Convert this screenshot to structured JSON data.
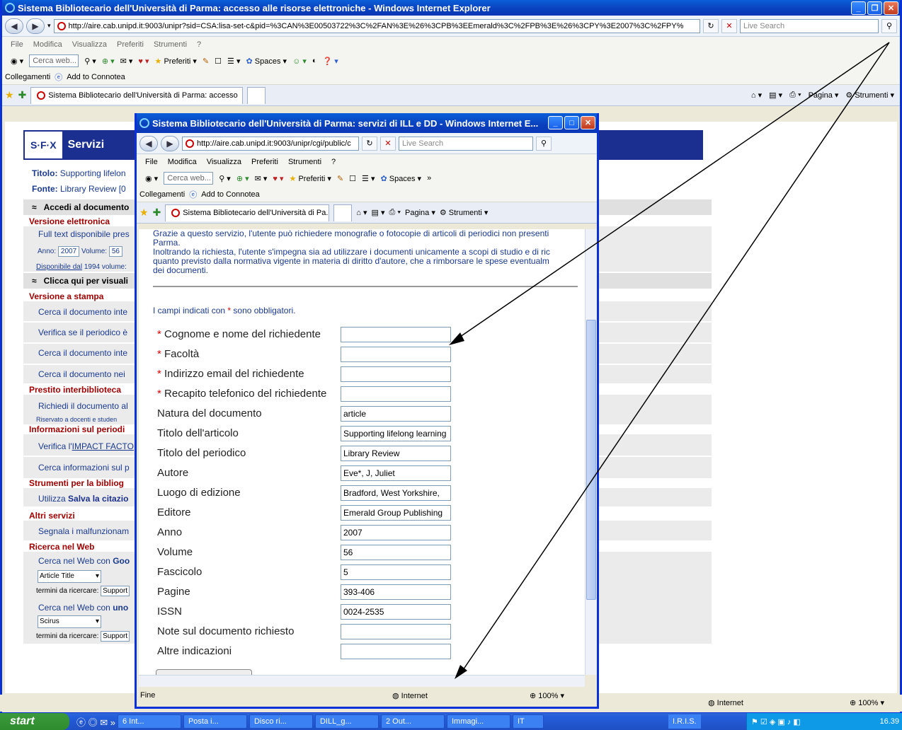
{
  "outer": {
    "title": "Sistema Bibliotecario dell'Università di Parma: accesso alle risorse elettroniche - Windows Internet Explorer",
    "address": "http://aire.cab.unipd.it:9003/unipr?sid=CSA:lisa-set-c&pid=%3CAN%3E00503722%3C%2FAN%3E%26%3CPB%3EEmerald%3C%2FPB%3E%26%3CPY%3E2007%3C%2FPY%",
    "search_placeholder": "Live Search",
    "menu": [
      "File",
      "Modifica",
      "Visualizza",
      "Preferiti",
      "Strumenti",
      "?"
    ],
    "search_web": "Cerca web...",
    "preferiti": "Preferiti",
    "spaces": "Spaces",
    "links_label": "Collegamenti",
    "add_connotea": "Add to Connotea",
    "tab": "Sistema Bibliotecario dell'Università di Parma: accesso",
    "pagina": "Pagina",
    "strumenti": "Strumenti",
    "status_zone": "Internet",
    "zoom": "100%"
  },
  "sfx": {
    "logo": "S·F·X",
    "header": "Servizi",
    "titolo_label": "Titolo:",
    "titolo_val": "Supporting lifelon",
    "fonte_label": "Fonte:",
    "fonte_val": "Library Review [0",
    "accedi": "Accedi al documento",
    "versione_elettronica": "Versione elettronica",
    "full_text": "Full text disponibile pres",
    "anno_label": "Anno:",
    "anno_val": "2007",
    "volume_label": "Volume:",
    "volume_val": "56",
    "disponibile": "Disponibile dal",
    "disponibile_rest": "1994 volume:",
    "clicca": "Clicca qui per visuali",
    "versione_stampa": "Versione a stampa",
    "cerca1": "Cerca il documento inte",
    "verifica": "Verifica se il periodico è",
    "cerca2": "Cerca il documento inte",
    "cerca3": "Cerca il documento nei",
    "prestito": "Prestito interbiblioteca",
    "richiedi": "Richiedi il documento al",
    "riservato": "Riservato a docenti e studen",
    "informazioni": "Informazioni sul periodi",
    "verifica_impact": "Verifica l'",
    "impact_link": "IMPACT FACTO",
    "cerca_info": "Cerca informazioni sul p",
    "strumenti_biblio": "Strumenti per la bibliog",
    "utilizza": "Utilizza",
    "salva": "Salva la citazio",
    "altri": "Altri servizi",
    "segnala": "Segnala i malfunzionam",
    "ricerca_web": "Ricerca nel Web",
    "cerca_goo": "Cerca nel Web con",
    "goo": "Goo",
    "select1": "Article Title",
    "termini1": "termini da ricercare:",
    "termini_val": "Support",
    "cerca_uno": "Cerca nel Web con",
    "uno": "uno",
    "select2": "Scirus",
    "termini2": "termini da ricercare:"
  },
  "inner": {
    "title": "Sistema Bibliotecario dell'Università di Parma: servizi di ILL e DD - Windows Internet E...",
    "address": "http://aire.cab.unipd.it:9003/unipr/cgi/public/c",
    "search_placeholder": "Live Search",
    "menu": [
      "File",
      "Modifica",
      "Visualizza",
      "Preferiti",
      "Strumenti",
      "?"
    ],
    "search_web": "Cerca web...",
    "preferiti": "Preferiti",
    "spaces": "Spaces",
    "links_label": "Collegamenti",
    "add_connotea": "Add to Connotea",
    "tab": "Sistema Bibliotecario dell'Università di Pa...",
    "pagina": "Pagina",
    "strumenti": "Strumenti",
    "intro1": "Grazie a questo servizio, l'utente può richiedere monografie o fotocopie di articoli di periodici non presenti",
    "intro2": "Parma.",
    "intro3": "Inoltrando la richiesta, l'utente s'impegna sia ad utilizzare i documenti unicamente a scopi di studio e di ric",
    "intro4": "quanto previsto dalla normativa vigente in materia di diritto d'autore, che a rimborsare le spese eventualm",
    "intro5": "dei documenti.",
    "required_note_a": "I campi indicati con",
    "required_star": "*",
    "required_note_b": "sono obbligatori.",
    "status_left": "Fine",
    "status_zone": "Internet",
    "zoom": "100%",
    "fields": [
      {
        "label": "Cognome e nome del richiedente",
        "required": true,
        "value": ""
      },
      {
        "label": "Facoltà",
        "required": true,
        "value": ""
      },
      {
        "label": "Indirizzo email del richiedente",
        "required": true,
        "value": ""
      },
      {
        "label": "Recapito telefonico del richiedente",
        "required": true,
        "value": ""
      },
      {
        "label": "Natura del documento",
        "required": false,
        "value": "article"
      },
      {
        "label": "Titolo dell'articolo",
        "required": false,
        "value": "Supporting lifelong learning"
      },
      {
        "label": "Titolo del periodico",
        "required": false,
        "value": "Library Review"
      },
      {
        "label": "Autore",
        "required": false,
        "value": "Eve*, J, Juliet"
      },
      {
        "label": "Luogo di edizione",
        "required": false,
        "value": "Bradford, West Yorkshire,"
      },
      {
        "label": "Editore",
        "required": false,
        "value": "Emerald Group Publishing"
      },
      {
        "label": "Anno",
        "required": false,
        "value": "2007"
      },
      {
        "label": "Volume",
        "required": false,
        "value": "56"
      },
      {
        "label": "Fascicolo",
        "required": false,
        "value": "5"
      },
      {
        "label": "Pagine",
        "required": false,
        "value": "393-406"
      },
      {
        "label": "ISSN",
        "required": false,
        "value": "0024-2535"
      },
      {
        "label": "Note sul documento richiesto",
        "required": false,
        "value": ""
      },
      {
        "label": "Altre indicazioni",
        "required": false,
        "value": ""
      }
    ]
  },
  "taskbar": {
    "start": "start",
    "items": [
      "6 Int...",
      "Posta i...",
      "Disco ri...",
      "DILL_g...",
      "2 Out...",
      "Immagi...",
      "IT"
    ],
    "iris": "I.R.I.S.",
    "clock": "16.39"
  }
}
